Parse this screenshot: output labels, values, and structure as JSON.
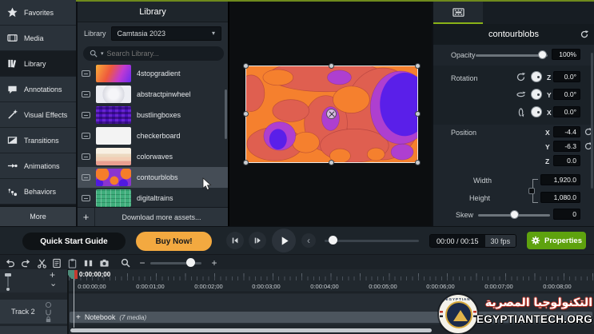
{
  "icons": {
    "plus": "+",
    "minus": "−",
    "chevron_down": "⌄",
    "chevron_left": "‹",
    "caret_down": "▾",
    "map": {
      "favorites": "star-icon",
      "media": "film-frame-icon",
      "library": "books-icon",
      "annotations": "speech-bubble-icon",
      "visual_effects": "magic-wand-icon",
      "transitions": "transition-square-icon",
      "animations": "arrow-dot-icon",
      "behaviors": "bouncing-dots-icon",
      "search": "magnifier-icon",
      "reset": "circular-arrow-icon",
      "properties": "gear-icon"
    }
  },
  "sidebar": {
    "items": [
      {
        "label": "Favorites"
      },
      {
        "label": "Media"
      },
      {
        "label": "Library"
      },
      {
        "label": "Annotations"
      },
      {
        "label": "Visual Effects"
      },
      {
        "label": "Transitions"
      },
      {
        "label": "Animations"
      },
      {
        "label": "Behaviors"
      }
    ],
    "more_label": "More"
  },
  "library": {
    "title": "Library",
    "dropdown_label": "Library",
    "dropdown_value": "Camtasia 2023",
    "search_placeholder": "Search Library...",
    "items": [
      {
        "name": "4stopgradient"
      },
      {
        "name": "abstractpinwheel"
      },
      {
        "name": "bustlingboxes"
      },
      {
        "name": "checkerboard"
      },
      {
        "name": "colorwaves"
      },
      {
        "name": "contourblobs"
      },
      {
        "name": "digitaltrains"
      }
    ],
    "download_label": "Download more assets..."
  },
  "properties": {
    "panel_title": "contourblobs",
    "opacity": {
      "label": "Opacity",
      "value": "100%"
    },
    "rotation": {
      "label": "Rotation",
      "rows": [
        {
          "axis": "Z",
          "value": "0.0°"
        },
        {
          "axis": "Y",
          "value": "0.0°"
        },
        {
          "axis": "X",
          "value": "0.0°"
        }
      ]
    },
    "position": {
      "label": "Position",
      "rows": [
        {
          "axis": "X",
          "value": "-4.4"
        },
        {
          "axis": "Y",
          "value": "-6.3"
        },
        {
          "axis": "Z",
          "value": "0.0"
        }
      ]
    },
    "size": {
      "width_label": "Width",
      "width_value": "1,920.0",
      "height_label": "Height",
      "height_value": "1,080.0"
    },
    "skew": {
      "label": "Skew",
      "value": "0"
    }
  },
  "controls": {
    "quick_start": "Quick Start Guide",
    "buy_now": "Buy Now!",
    "time": "00:00 / 00:15",
    "fps": "30 fps",
    "properties_button": "Properties"
  },
  "timeline": {
    "playhead_label": "0:00:00;00",
    "ruler_labels": [
      "0:00:00;00",
      "0:00:01;00",
      "0:00:02;00",
      "0:00:03;00",
      "0:00:04;00",
      "0:00:05;00",
      "0:00:06;00",
      "0:00:07;00",
      "0:00:08;00"
    ],
    "track_label": "Track 2",
    "group": {
      "plus": "+",
      "name": "Notebook",
      "count": "(7 media)"
    }
  },
  "colors": {
    "accent_green": "#8ab217",
    "properties_green": "#5ea20e",
    "buy_orange": "#f3a940",
    "blob_orange": "#f5802e",
    "blob_salmon": "#df5f50",
    "blob_purple": "#ae3fd0",
    "blob_indigo": "#5a1fe9"
  },
  "watermark": {
    "arabic": "التكنولوجيا المصرية",
    "site": "EGYPTIANTECH.ORG",
    "ring_text": "EGYPTIAN"
  }
}
